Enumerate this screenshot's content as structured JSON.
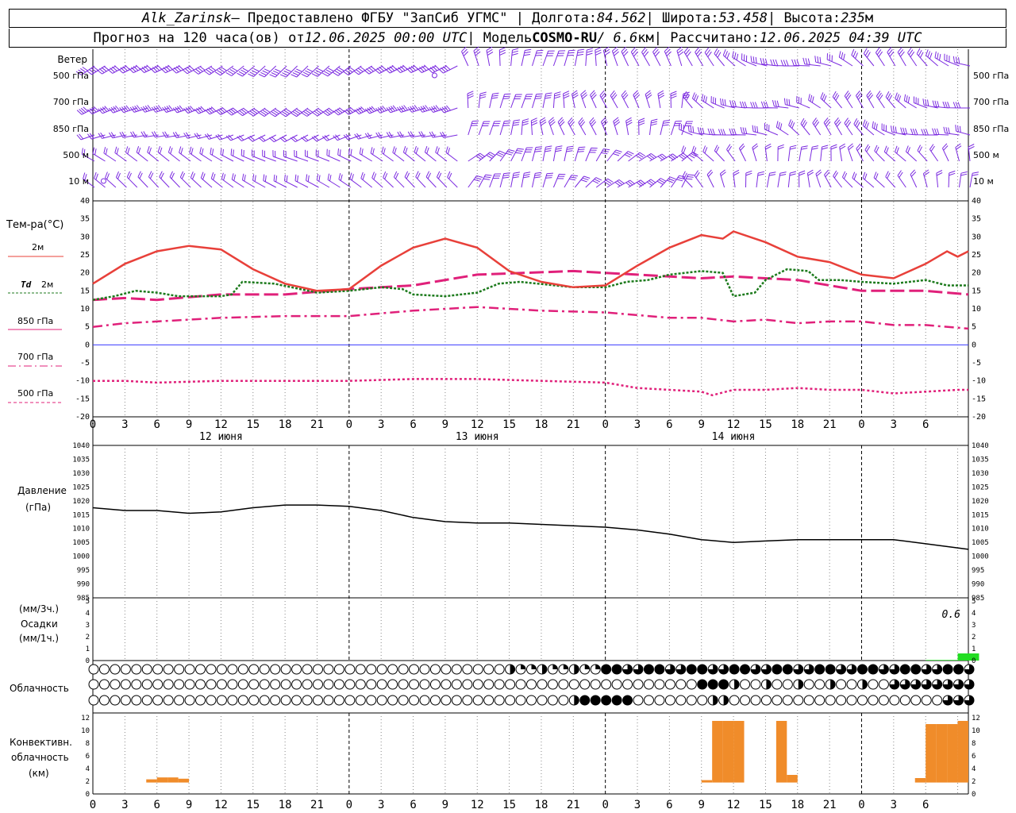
{
  "header": {
    "station": "Alk_Zarinsk",
    "provider": " – Предоставлено ФГБУ \"ЗапСиб УГМС\" | Долгота: ",
    "lon": "84.562",
    "lat_label": " | Широта: ",
    "lat": "53.458",
    "alt_label": " | Высота: ",
    "alt": "235",
    "alt_unit": "м",
    "forecast_label": "Прогноз на 120 часа(ов) от ",
    "start": "12.06.2025 00:00 UTC",
    "model_label": " | Модель ",
    "model": "COSMO-RU",
    "res": " / 6.6",
    "res_unit": "км",
    "calc_label": " | Рассчитано: ",
    "calc": "12.06.2025 04:39 UTC"
  },
  "colors": {
    "wind": "#7b2ae0",
    "t2m": "#e8403a",
    "td2m": "#1c7a1c",
    "t850": "#e0207a",
    "t700": "#e0207a",
    "t500": "#e0207a",
    "zero_line": "#3a3aff",
    "pressure": "#000000",
    "precip": "#22dd22",
    "convective": "#f08c2a"
  },
  "wind_panel": {
    "title": "Ветер",
    "levels": [
      "500 гПа",
      "700 гПа",
      "850 гПа",
      "500 м",
      "10 м"
    ]
  },
  "axes": {
    "x_hour_ticks": [
      "0",
      "3",
      "6",
      "9",
      "12",
      "15",
      "18",
      "21",
      "0",
      "3",
      "6",
      "9",
      "12",
      "15",
      "18",
      "21",
      "0",
      "3",
      "6",
      "9",
      "12",
      "15",
      "18",
      "21",
      "0",
      "3",
      "6"
    ],
    "day_labels": [
      "12 июня",
      "13 июня",
      "14 июня"
    ],
    "temp_ticks": [
      "40",
      "35",
      "30",
      "25",
      "20",
      "15",
      "10",
      "5",
      "0",
      "-5",
      "-10",
      "-15",
      "-20"
    ],
    "pressure_ticks": [
      "1040",
      "1035",
      "1030",
      "1025",
      "1020",
      "1015",
      "1010",
      "1005",
      "1000",
      "995",
      "990",
      "985"
    ],
    "precip_ticks": [
      "5",
      "4",
      "3",
      "2",
      "1",
      "0"
    ],
    "conv_ticks": [
      "12",
      "10",
      "8",
      "6",
      "4",
      "2",
      "0"
    ]
  },
  "labels": {
    "temp_title": "Тем-ра(°С)",
    "t2m": "2м",
    "td": "Td",
    "td_h": "2м",
    "t850": "850 гПа",
    "t700": "700 гПа",
    "t500": "500 гПа",
    "pressure_1": "Давление",
    "pressure_2": "(гПа)",
    "precip_1": "(мм/3ч.)",
    "precip_2": "Осадки",
    "precip_3": "(мм/1ч.)",
    "precip_value": "0.6",
    "clouds": "Облачность",
    "conv_1": "Конвективн.",
    "conv_2": "облачность",
    "conv_3": "(км)"
  },
  "chart_data": {
    "type": "line",
    "hours": 78,
    "temperature": {
      "ylim": [
        -20,
        40
      ],
      "t2m": [
        [
          0,
          17
        ],
        [
          3,
          22.5
        ],
        [
          6,
          26
        ],
        [
          9,
          27.5
        ],
        [
          12,
          26.5
        ],
        [
          15,
          21
        ],
        [
          18,
          17
        ],
        [
          21,
          15
        ],
        [
          24,
          15.5
        ],
        [
          27,
          22
        ],
        [
          30,
          27
        ],
        [
          33,
          29.5
        ],
        [
          36,
          27
        ],
        [
          39,
          20.5
        ],
        [
          42,
          17.5
        ],
        [
          45,
          16
        ],
        [
          48,
          16.5
        ],
        [
          51,
          22
        ],
        [
          54,
          27
        ],
        [
          57,
          30.5
        ],
        [
          59,
          29.5
        ],
        [
          60,
          31.5
        ],
        [
          63,
          28.5
        ],
        [
          66,
          24.5
        ],
        [
          69,
          23
        ],
        [
          72,
          19.5
        ],
        [
          75,
          18.5
        ],
        [
          78,
          22.5
        ],
        [
          80,
          26
        ],
        [
          81,
          24.5
        ],
        [
          82,
          26
        ]
      ],
      "td2m": [
        [
          0,
          12.5
        ],
        [
          2,
          13.5
        ],
        [
          4,
          15
        ],
        [
          6,
          14.5
        ],
        [
          8,
          13.5
        ],
        [
          12,
          13.5
        ],
        [
          13,
          14
        ],
        [
          14,
          17.5
        ],
        [
          17,
          17
        ],
        [
          21,
          14.5
        ],
        [
          24,
          15
        ],
        [
          27,
          16
        ],
        [
          29,
          15.5
        ],
        [
          30,
          14
        ],
        [
          33,
          13.5
        ],
        [
          36,
          14.5
        ],
        [
          38,
          17
        ],
        [
          40,
          17.5
        ],
        [
          45,
          16
        ],
        [
          48,
          16
        ],
        [
          50,
          17.5
        ],
        [
          52,
          18
        ],
        [
          54,
          19.5
        ],
        [
          57,
          20.5
        ],
        [
          59,
          20
        ],
        [
          60,
          13.5
        ],
        [
          62,
          14.5
        ],
        [
          63,
          18
        ],
        [
          65,
          21
        ],
        [
          67,
          20.5
        ],
        [
          68,
          18
        ],
        [
          70,
          18
        ],
        [
          72,
          17.5
        ],
        [
          75,
          17
        ],
        [
          78,
          18
        ],
        [
          80,
          16.5
        ],
        [
          82,
          16.5
        ]
      ],
      "t850": [
        [
          0,
          12.5
        ],
        [
          3,
          13
        ],
        [
          6,
          12.5
        ],
        [
          12,
          14
        ],
        [
          18,
          14
        ],
        [
          24,
          15.5
        ],
        [
          30,
          16.5
        ],
        [
          36,
          19.5
        ],
        [
          45,
          20.5
        ],
        [
          48,
          20
        ],
        [
          54,
          19
        ],
        [
          57,
          18.5
        ],
        [
          60,
          19
        ],
        [
          63,
          18.5
        ],
        [
          66,
          18
        ],
        [
          69,
          16.5
        ],
        [
          72,
          15
        ],
        [
          78,
          15
        ],
        [
          82,
          14
        ]
      ],
      "t700": [
        [
          0,
          5
        ],
        [
          3,
          6
        ],
        [
          6,
          6.5
        ],
        [
          12,
          7.5
        ],
        [
          18,
          8
        ],
        [
          24,
          8
        ],
        [
          30,
          9.5
        ],
        [
          36,
          10.5
        ],
        [
          42,
          9.5
        ],
        [
          48,
          9
        ],
        [
          54,
          7.5
        ],
        [
          57,
          7.5
        ],
        [
          60,
          6.5
        ],
        [
          63,
          7
        ],
        [
          66,
          6
        ],
        [
          69,
          6.5
        ],
        [
          72,
          6.5
        ],
        [
          75,
          5.5
        ],
        [
          78,
          5.5
        ],
        [
          82,
          4.5
        ]
      ],
      "t500": [
        [
          0,
          -10
        ],
        [
          3,
          -10
        ],
        [
          6,
          -10.5
        ],
        [
          12,
          -10
        ],
        [
          18,
          -10
        ],
        [
          24,
          -10
        ],
        [
          30,
          -9.5
        ],
        [
          36,
          -9.5
        ],
        [
          42,
          -10
        ],
        [
          48,
          -10.5
        ],
        [
          51,
          -12
        ],
        [
          54,
          -12.5
        ],
        [
          57,
          -13
        ],
        [
          58,
          -14
        ],
        [
          60,
          -12.5
        ],
        [
          63,
          -12.5
        ],
        [
          66,
          -12
        ],
        [
          69,
          -12.5
        ],
        [
          72,
          -12.5
        ],
        [
          75,
          -13.5
        ],
        [
          78,
          -13
        ],
        [
          81,
          -12.5
        ],
        [
          82,
          -12.5
        ]
      ]
    },
    "pressure": {
      "ylim": [
        985,
        1040
      ],
      "series": [
        [
          0,
          1017.5
        ],
        [
          3,
          1016.5
        ],
        [
          6,
          1016.5
        ],
        [
          9,
          1015.5
        ],
        [
          12,
          1016
        ],
        [
          15,
          1017.5
        ],
        [
          18,
          1018.5
        ],
        [
          21,
          1018.5
        ],
        [
          24,
          1018
        ],
        [
          27,
          1016.5
        ],
        [
          30,
          1014
        ],
        [
          33,
          1012.5
        ],
        [
          36,
          1012
        ],
        [
          39,
          1012
        ],
        [
          42,
          1011.5
        ],
        [
          45,
          1011
        ],
        [
          48,
          1010.5
        ],
        [
          51,
          1009.5
        ],
        [
          54,
          1008
        ],
        [
          57,
          1006
        ],
        [
          60,
          1005
        ],
        [
          63,
          1005.5
        ],
        [
          66,
          1006
        ],
        [
          69,
          1006
        ],
        [
          72,
          1006
        ],
        [
          75,
          1006
        ],
        [
          78,
          1004.5
        ],
        [
          80,
          1003.5
        ],
        [
          82,
          1002.5
        ]
      ]
    },
    "precipitation": {
      "ylim": [
        0,
        5
      ],
      "series": [
        [
          78,
          0.05
        ],
        [
          79,
          0.05
        ],
        [
          80,
          0.05
        ],
        [
          81,
          0.6
        ],
        [
          82,
          0.6
        ]
      ]
    },
    "convective_clouds": {
      "ylim": [
        0,
        12
      ],
      "bars": [
        [
          5,
          2.3
        ],
        [
          6,
          2.6
        ],
        [
          7,
          2.6
        ],
        [
          8,
          2.4
        ],
        [
          57,
          1.8
        ],
        [
          58,
          11.5
        ],
        [
          59,
          11.5
        ],
        [
          60,
          11.5
        ],
        [
          64,
          11.5
        ],
        [
          65,
          3
        ],
        [
          77,
          2.5
        ],
        [
          78,
          11
        ],
        [
          79,
          11
        ],
        [
          80,
          11
        ],
        [
          81,
          11.5
        ]
      ]
    },
    "cloud_rows": 3
  }
}
